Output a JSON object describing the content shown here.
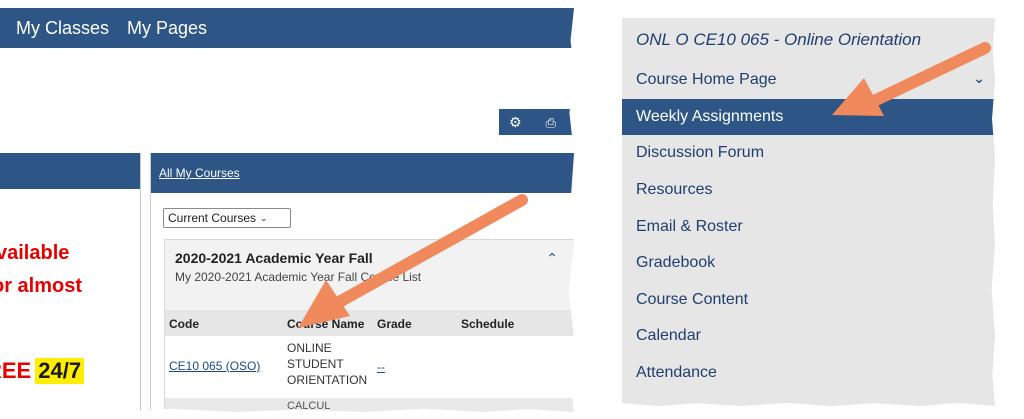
{
  "top_nav": {
    "items": [
      "My Classes",
      "My Pages"
    ]
  },
  "toolbar": {
    "gear_icon": "gear-icon",
    "print_icon": "print-icon"
  },
  "promo": {
    "line1": "vailable",
    "line2": "or almost",
    "line3_prefix": "REE",
    "line3_highlight": "24/7"
  },
  "courses": {
    "header_link": "All My Courses",
    "select_value": "Current Courses",
    "year_title": "2020-2021 Academic Year Fall",
    "year_subtitle": "My 2020-2021 Academic Year Fall Course List",
    "columns": [
      "Code",
      "Course Name",
      "Grade",
      "Schedule"
    ],
    "rows": [
      {
        "code": "CE10 065 (OSO)",
        "name": "ONLINE STUDENT ORIENTATION",
        "grade": "--"
      },
      {
        "name": "CALCUL"
      }
    ]
  },
  "course_menu": {
    "title": "ONL O CE10 065 - Online Orientation",
    "items": [
      "Course Home Page",
      "Weekly Assignments",
      "Discussion Forum",
      "Resources",
      "Email & Roster",
      "Gradebook",
      "Course Content",
      "Calendar",
      "Attendance"
    ],
    "active_index": 1
  },
  "colors": {
    "nav_blue": "#2d5686",
    "arrow_orange": "#f08a5d",
    "promo_red": "#e60000",
    "highlight_yellow": "#ffee00"
  }
}
